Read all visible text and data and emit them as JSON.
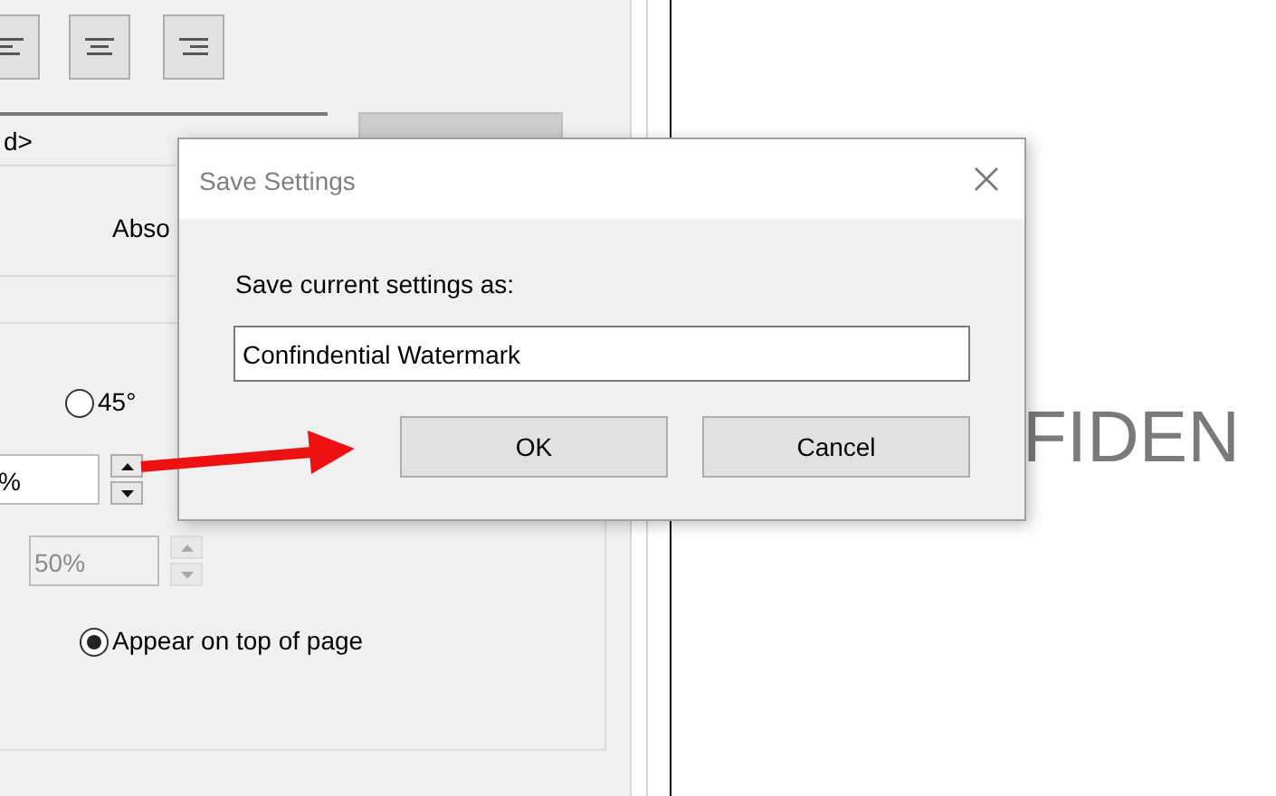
{
  "background_panel": {
    "file_field_value": "d>",
    "position_label": "Abso",
    "rotation_radio": {
      "label": "45°",
      "selected": false
    },
    "spin_fields": [
      {
        "value": "%",
        "disabled": false
      },
      {
        "value": "50%",
        "disabled": true
      }
    ],
    "layer_radio": {
      "label": "Appear on top of page",
      "selected": true
    }
  },
  "preview": {
    "watermark_text": "FIDEN"
  },
  "dialog": {
    "title": "Save Settings",
    "prompt": "Save current settings as:",
    "name_field": {
      "value": "Confindential Watermark"
    },
    "buttons": [
      "OK",
      "Cancel"
    ]
  }
}
